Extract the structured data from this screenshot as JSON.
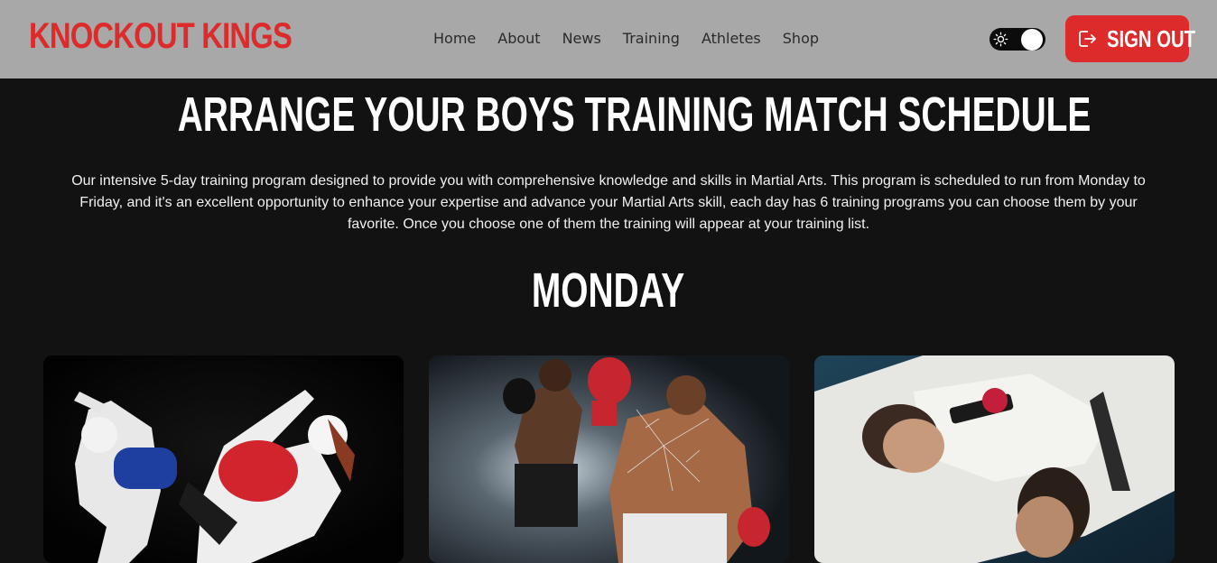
{
  "header": {
    "logo": "KNOCKOUT KINGS",
    "nav": [
      "Home",
      "About",
      "News",
      "Training",
      "Athletes",
      "Shop"
    ],
    "theme_toggle_state": "light",
    "signout_label": "SIGN OUT"
  },
  "main": {
    "title": "ARRANGE YOUR BOYS TRAINING MATCH SCHEDULE",
    "description": "Our intensive 5-day training program designed to provide you with comprehensive knowledge and skills in Martial Arts. This program is scheduled to run from Monday to Friday, and it's an excellent opportunity to enhance your expertise and advance your Martial Arts skill, each day has 6 training programs you can choose them by your favorite. Once you choose one of them the training will appear at your training list.",
    "day": "MONDAY",
    "cards": [
      {
        "image": "taekwondo-kick-photo"
      },
      {
        "image": "boxing-punch-photo"
      },
      {
        "image": "jiu-jitsu-grapple-photo"
      }
    ]
  },
  "colors": {
    "header_bg": "#a8a8a8",
    "brand_red": "#dd2a2a",
    "page_bg": "#121212"
  }
}
